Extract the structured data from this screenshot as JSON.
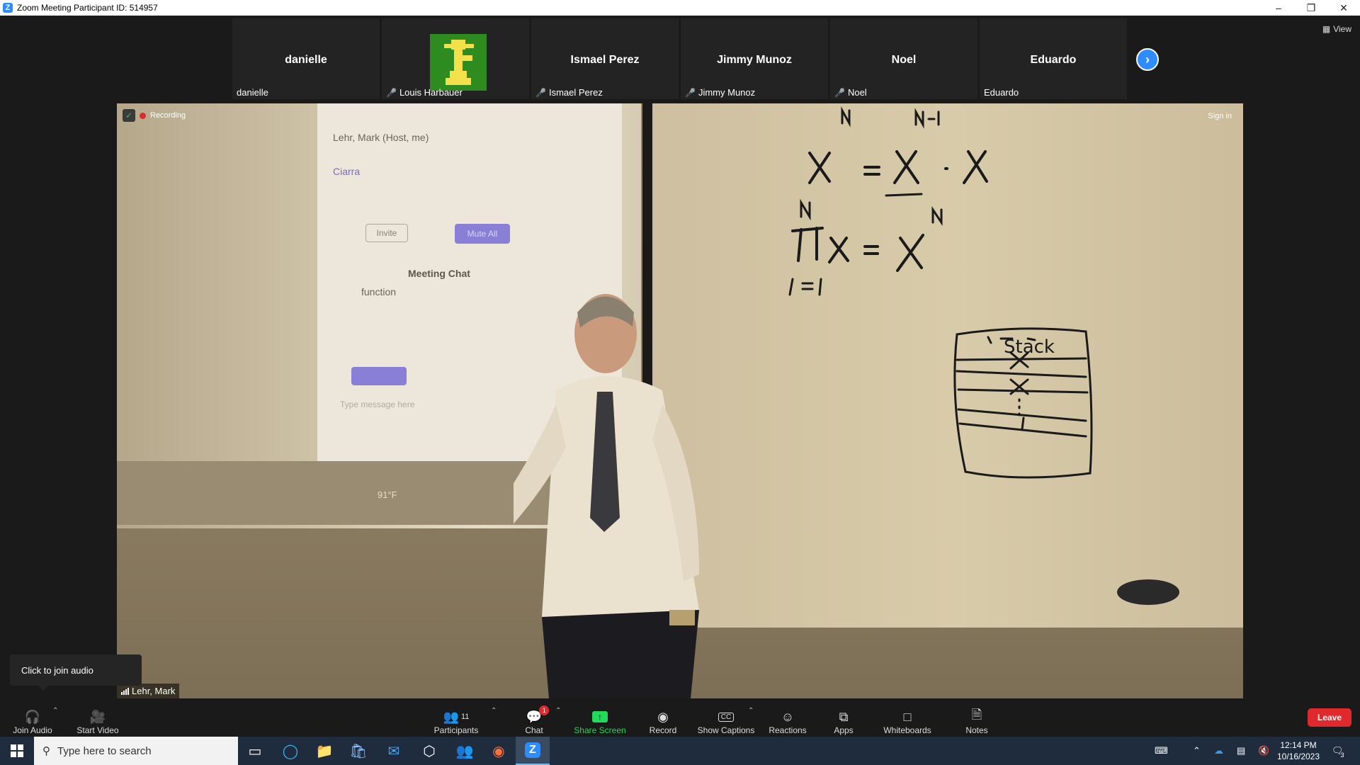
{
  "window": {
    "title": "Zoom Meeting Participant ID: 514957"
  },
  "participants": [
    {
      "display": "danielle",
      "label": "danielle",
      "muted": false,
      "has_video": false
    },
    {
      "display": "",
      "label": "Louis Harbauer",
      "muted": true,
      "has_video": true
    },
    {
      "display": "Ismael Perez",
      "label": "Ismael Perez",
      "muted": true,
      "has_video": false
    },
    {
      "display": "Jimmy Munoz",
      "label": "Jimmy Munoz",
      "muted": true,
      "has_video": false
    },
    {
      "display": "Noel",
      "label": "Noel",
      "muted": true,
      "has_video": false
    },
    {
      "display": "Eduardo",
      "label": "Eduardo",
      "muted": false,
      "has_video": false
    }
  ],
  "view_label": "View",
  "video": {
    "recording_label": "Recording",
    "sign_in": "Sign in",
    "speaker_name": "Lehr, Mark",
    "projection": {
      "host_row": "Lehr, Mark (Host, me)",
      "second_row": "Ciarra",
      "invite": "Invite",
      "mute_all": "Mute All",
      "chat_title": "Meeting Chat",
      "chat_line": "function",
      "chat_placeholder": "Type message here",
      "temperature": "91°F"
    }
  },
  "tooltip": "Click to join audio",
  "toolbar": {
    "join_audio": "Join Audio",
    "start_video": "Start Video",
    "participants": "Participants",
    "participants_count": "11",
    "chat": "Chat",
    "chat_badge": "1",
    "share_screen": "Share Screen",
    "record": "Record",
    "show_captions": "Show Captions",
    "reactions": "Reactions",
    "apps": "Apps",
    "whiteboards": "Whiteboards",
    "notes": "Notes",
    "leave": "Leave"
  },
  "taskbar": {
    "search_placeholder": "Type here to search",
    "time": "12:14 PM",
    "date": "10/16/2023",
    "notifications": "3"
  },
  "colors": {
    "accent": "#2d8cff",
    "leave": "#e0292d",
    "share": "#23d959"
  }
}
